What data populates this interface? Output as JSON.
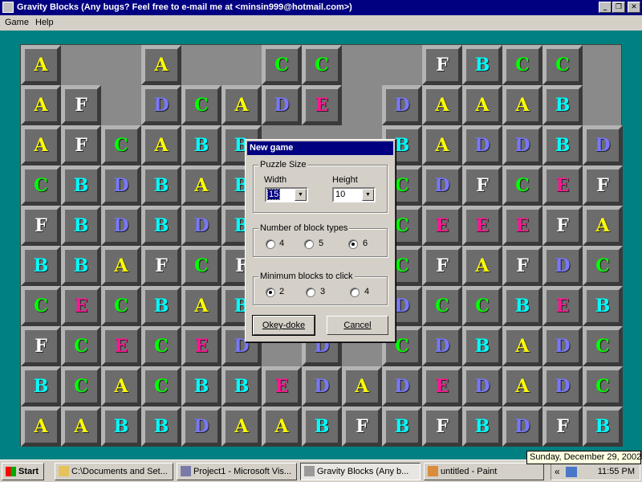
{
  "window": {
    "title": "Gravity Blocks   (Any bugs? Feel free to e-mail me at <minsin999@hotmail.com>)",
    "minimize_glyph": "_",
    "restore_glyph": "❐",
    "close_glyph": "✕"
  },
  "menu": {
    "items": [
      "Game",
      "Help"
    ]
  },
  "colors": {
    "A": "#ffff00",
    "B": "#00ffff",
    "C": "#00ff00",
    "D": "#7878ff",
    "E": "#ff1493",
    "F": "#ffffff"
  },
  "board": {
    "columns": 15,
    "rows": 10,
    "grid": [
      "A..A..CC..FBCC.",
      "AF.DCADE.DAAAB.",
      "AFCABB...BADDBD",
      "CBDBAB...CDFCEF",
      "FBDBDB...CEEEFA",
      "BBAFCF...CFAFDC",
      "CECBAB...DCCBEB",
      "FCECED.D.CDBADC",
      "BCACBBEDADEDADC",
      "AABBDAABFBFBDFB"
    ]
  },
  "dialog": {
    "title": "New game",
    "puzzle_size": {
      "label": "Puzzle Size",
      "width_label": "Width",
      "width_value": "15",
      "height_label": "Height",
      "height_value": "10"
    },
    "block_types": {
      "label": "Number of block types",
      "options": [
        "4",
        "5",
        "6"
      ],
      "selected": "6"
    },
    "min_blocks": {
      "label": "Minimum blocks to click",
      "options": [
        "2",
        "3",
        "4"
      ],
      "selected": "2"
    },
    "ok_label": "Okey-doke",
    "cancel_label": "Cancel"
  },
  "taskbar": {
    "start_label": "Start",
    "tasks": [
      {
        "label": "C:\\Documents and Set...",
        "active": false
      },
      {
        "label": "Project1 - Microsoft Vis...",
        "active": false
      },
      {
        "label": "Gravity Blocks   (Any b...",
        "active": true
      },
      {
        "label": "untitled - Paint",
        "active": false
      }
    ],
    "tray_chevron": "«",
    "clock": "11:55 PM"
  },
  "tooltip": "Sunday, December 29, 2002"
}
